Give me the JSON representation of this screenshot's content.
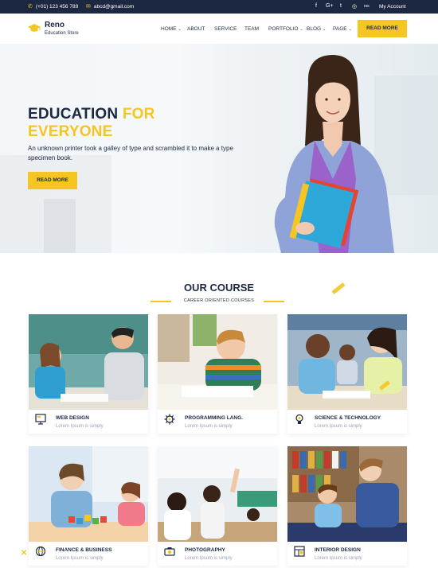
{
  "topbar": {
    "phone": "(+01) 123 456 789",
    "email": "abcd@gmail.com",
    "social": [
      "f",
      "G+",
      "t",
      "◎",
      "rss"
    ],
    "account": "My Account"
  },
  "brand": {
    "name": "Reno",
    "tagline": "Education Store"
  },
  "nav": [
    {
      "label": "HOME",
      "dropdown": true
    },
    {
      "label": "ABOUT",
      "dropdown": false
    },
    {
      "label": "SERVICE",
      "dropdown": false
    },
    {
      "label": "TEAM",
      "dropdown": false
    },
    {
      "label": "PORTFOLIO",
      "dropdown": true
    },
    {
      "label": "BLOG",
      "dropdown": true
    },
    {
      "label": "PAGE",
      "dropdown": true
    }
  ],
  "header_button": "READ MORE",
  "hero": {
    "title_line1_dark": "EDUCATION ",
    "title_line1_accent": "FOR",
    "title_line2_accent": "EVERYONE",
    "text": "An unknown printer took a galley of type and scrambled it to make a type specimen book.",
    "button": "READ MORE"
  },
  "courses": {
    "title": "OUR COURSE",
    "subtitle": "CAREER ORIENTED COURSES",
    "items": [
      {
        "title": "WEB DESIGN",
        "sub": "Lorem Ipsum is simply",
        "icon": "monitor-icon"
      },
      {
        "title": "PROGRAMMING LANG.",
        "sub": "Lorem Ipsum is simply",
        "icon": "gear-icon"
      },
      {
        "title": "SCIENCE & TECHNOLOGY",
        "sub": "Lorem Ipsum is simply",
        "icon": "bulb-icon"
      },
      {
        "title": "FINANCE & BUSINESS",
        "sub": "Lorem Ipsum is simply",
        "icon": "globe-icon"
      },
      {
        "title": "PHOTOGRAPHY",
        "sub": "Lorem Ipsum is simply",
        "icon": "camera-icon"
      },
      {
        "title": "INTERIOR DESIGN",
        "sub": "Lorem Ipsum is simply",
        "icon": "layout-icon"
      }
    ]
  },
  "colors": {
    "navy": "#1c2841",
    "accent": "#f5c522",
    "muted": "#9aa3b2"
  }
}
